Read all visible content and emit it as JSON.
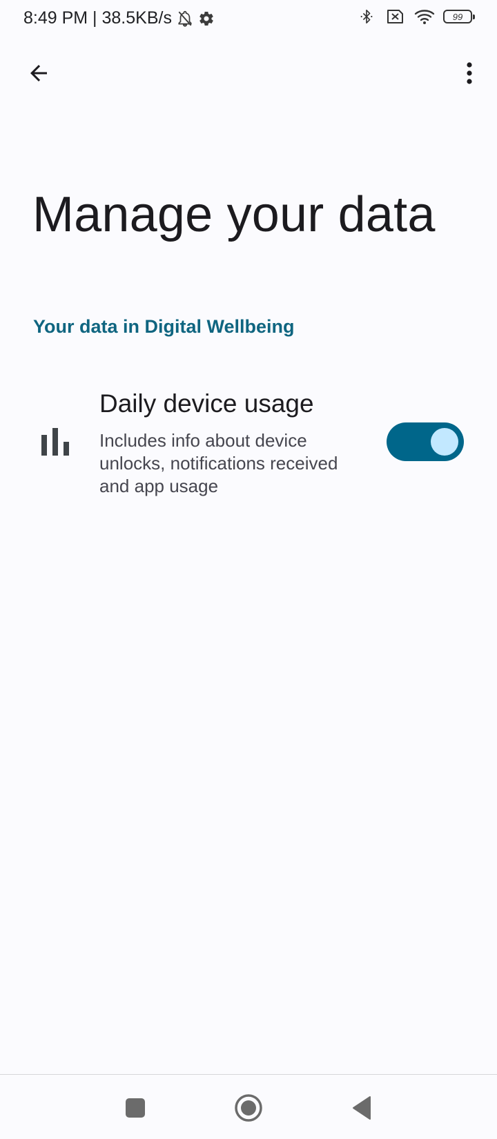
{
  "status_bar": {
    "time_speed": "8:49 PM | 38.5KB/s",
    "left_icons": [
      "notifications-off-icon",
      "settings-gear-icon"
    ],
    "right_icons": [
      "bluetooth-icon",
      "sim-off-icon",
      "wifi-icon"
    ],
    "battery_level": "99"
  },
  "top_bar": {
    "back_icon": "arrow-back-icon",
    "menu_icon": "more-vert-icon"
  },
  "page": {
    "title": "Manage your data",
    "section_header": "Your data in Digital Wellbeing"
  },
  "settings": {
    "daily_usage": {
      "icon": "bar-chart-icon",
      "title": "Daily device usage",
      "description": "Includes info about device unlocks, notifications received and app usage",
      "toggle_on": true
    }
  },
  "nav_bar": {
    "recents_icon": "recents-square-icon",
    "home_icon": "home-circle-icon",
    "back_icon": "back-triangle-icon"
  },
  "colors": {
    "background": "#fbfbfe",
    "accent": "#0f6580",
    "toggle_track": "#00668a",
    "toggle_thumb": "#c2e8ff",
    "text_primary": "#1c1b1f",
    "text_secondary": "#46464f"
  }
}
